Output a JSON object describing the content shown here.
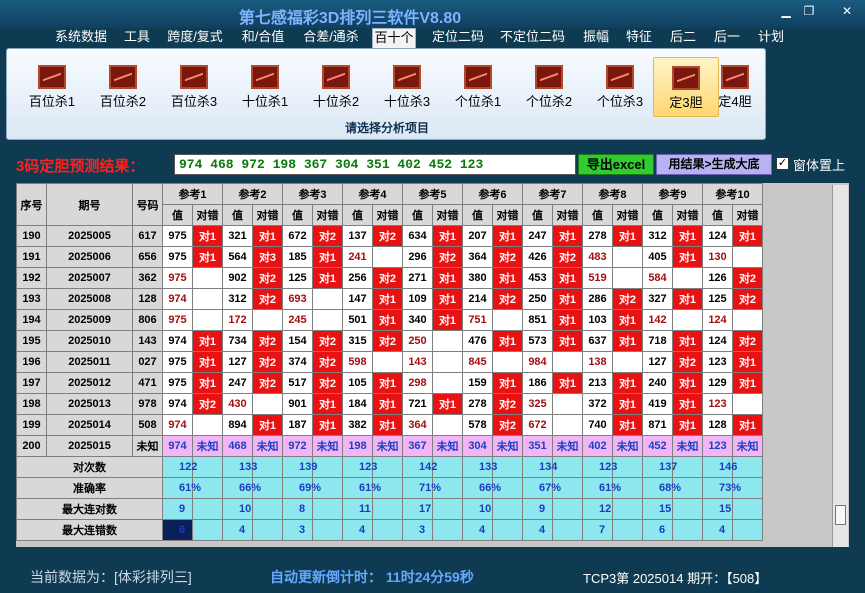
{
  "window": {
    "title": "第七感福彩3D排列三软件V8.80"
  },
  "menu": [
    "系统数据",
    "工具",
    "跨度/复式",
    "和/合值",
    "合差/通杀",
    "百十个",
    "定位二码",
    "不定位二码",
    "振幅",
    "特征",
    "后二",
    "后一",
    "计划"
  ],
  "ribbon": {
    "buttons": [
      "百位杀1",
      "百位杀2",
      "百位杀3",
      "十位杀1",
      "十位杀2",
      "十位杀3",
      "个位杀1",
      "个位杀2",
      "个位杀3",
      "定3胆",
      "定4胆"
    ],
    "caption": "请选择分析项目"
  },
  "result": {
    "label": "3码定胆预测结果：",
    "value": "974 468 972 198 367 304 351 402 452 123",
    "excel_button": "导出excel",
    "make_button": "用结果>生成大底",
    "ontop_label": "窗体置上",
    "ontop_checked": true
  },
  "table": {
    "head_seq": "序号",
    "head_period": "期号",
    "head_number": "号码",
    "groups": [
      "参考1",
      "参考2",
      "参考3",
      "参考4",
      "参考5",
      "参考6",
      "参考7",
      "参考8",
      "参考9",
      "参考10"
    ],
    "sub_val": "值",
    "sub_hit": "对错",
    "rows": [
      {
        "seq": "190",
        "period": "2025005",
        "num": "617",
        "cells": [
          "975",
          "对1",
          "321",
          "对1",
          "672",
          "对2",
          "137",
          "对2",
          "634",
          "对1",
          "207",
          "对1",
          "247",
          "对1",
          "278",
          "对1",
          "312",
          "对1",
          "124",
          "对1"
        ]
      },
      {
        "seq": "191",
        "period": "2025006",
        "num": "656",
        "cells": [
          "975",
          "对1",
          "564",
          "对3",
          "185",
          "对1",
          "241",
          "",
          "296",
          "对2",
          "364",
          "对2",
          "426",
          "对2",
          "483",
          "",
          "405",
          "对1",
          "130",
          ""
        ]
      },
      {
        "seq": "192",
        "period": "2025007",
        "num": "362",
        "cells": [
          "975",
          "",
          "902",
          "对2",
          "125",
          "对1",
          "256",
          "对2",
          "271",
          "对1",
          "380",
          "对1",
          "453",
          "对1",
          "519",
          "",
          "584",
          "",
          "126",
          "对2"
        ]
      },
      {
        "seq": "193",
        "period": "2025008",
        "num": "128",
        "cells": [
          "974",
          "",
          "312",
          "对2",
          "693",
          "",
          "147",
          "对1",
          "109",
          "对1",
          "214",
          "对2",
          "250",
          "对1",
          "286",
          "对2",
          "327",
          "对1",
          "125",
          "对2"
        ]
      },
      {
        "seq": "194",
        "period": "2025009",
        "num": "806",
        "cells": [
          "975",
          "",
          "172",
          "",
          "245",
          "",
          "501",
          "对1",
          "340",
          "对1",
          "751",
          "",
          "851",
          "对1",
          "103",
          "对1",
          "142",
          "",
          "124",
          ""
        ]
      },
      {
        "seq": "195",
        "period": "2025010",
        "num": "143",
        "cells": [
          "974",
          "对1",
          "734",
          "对2",
          "154",
          "对2",
          "315",
          "对2",
          "250",
          "",
          "476",
          "对1",
          "573",
          "对1",
          "637",
          "对1",
          "718",
          "对1",
          "124",
          "对2"
        ]
      },
      {
        "seq": "196",
        "period": "2025011",
        "num": "027",
        "cells": [
          "975",
          "对1",
          "127",
          "对2",
          "374",
          "对2",
          "598",
          "",
          "143",
          "",
          "845",
          "",
          "984",
          "",
          "138",
          "",
          "127",
          "对2",
          "123",
          "对1"
        ]
      },
      {
        "seq": "197",
        "period": "2025012",
        "num": "471",
        "cells": [
          "975",
          "对1",
          "247",
          "对2",
          "517",
          "对2",
          "105",
          "对1",
          "298",
          "",
          "159",
          "对1",
          "186",
          "对1",
          "213",
          "对1",
          "240",
          "对1",
          "129",
          "对1"
        ]
      },
      {
        "seq": "198",
        "period": "2025013",
        "num": "978",
        "cells": [
          "974",
          "对2",
          "430",
          "",
          "901",
          "对1",
          "184",
          "对1",
          "721",
          "对1",
          "278",
          "对2",
          "325",
          "",
          "372",
          "对1",
          "419",
          "对1",
          "123",
          ""
        ]
      },
      {
        "seq": "199",
        "period": "2025014",
        "num": "508",
        "cells": [
          "974",
          "",
          "894",
          "对1",
          "187",
          "对1",
          "382",
          "对1",
          "364",
          "",
          "578",
          "对2",
          "672",
          "",
          "740",
          "对1",
          "871",
          "对1",
          "128",
          "对1"
        ]
      }
    ],
    "predict": {
      "seq": "200",
      "period": "2025015",
      "num": "未知",
      "vals": [
        "974",
        "468",
        "972",
        "198",
        "367",
        "304",
        "351",
        "402",
        "452",
        "123"
      ],
      "hit_text": "未知"
    },
    "stats": [
      {
        "label": "对次数",
        "vals": [
          "122",
          "133",
          "139",
          "123",
          "142",
          "133",
          "134",
          "123",
          "137",
          "146"
        ]
      },
      {
        "label": "准确率",
        "vals": [
          "61%",
          "66%",
          "69%",
          "61%",
          "71%",
          "66%",
          "67%",
          "61%",
          "68%",
          "73%"
        ]
      },
      {
        "label": "最大连对数",
        "vals": [
          "9",
          "10",
          "8",
          "11",
          "17",
          "10",
          "9",
          "12",
          "15",
          "15"
        ]
      },
      {
        "label": "最大连错数",
        "vals": [
          "6",
          "4",
          "3",
          "4",
          "3",
          "4",
          "4",
          "7",
          "6",
          "4"
        ]
      }
    ]
  },
  "status": {
    "data_source": "当前数据为：[体彩排列三]",
    "countdown": "自动更新倒计时：  11时24分59秒",
    "draw": "TCP3第 2025014 期开：【508】"
  }
}
